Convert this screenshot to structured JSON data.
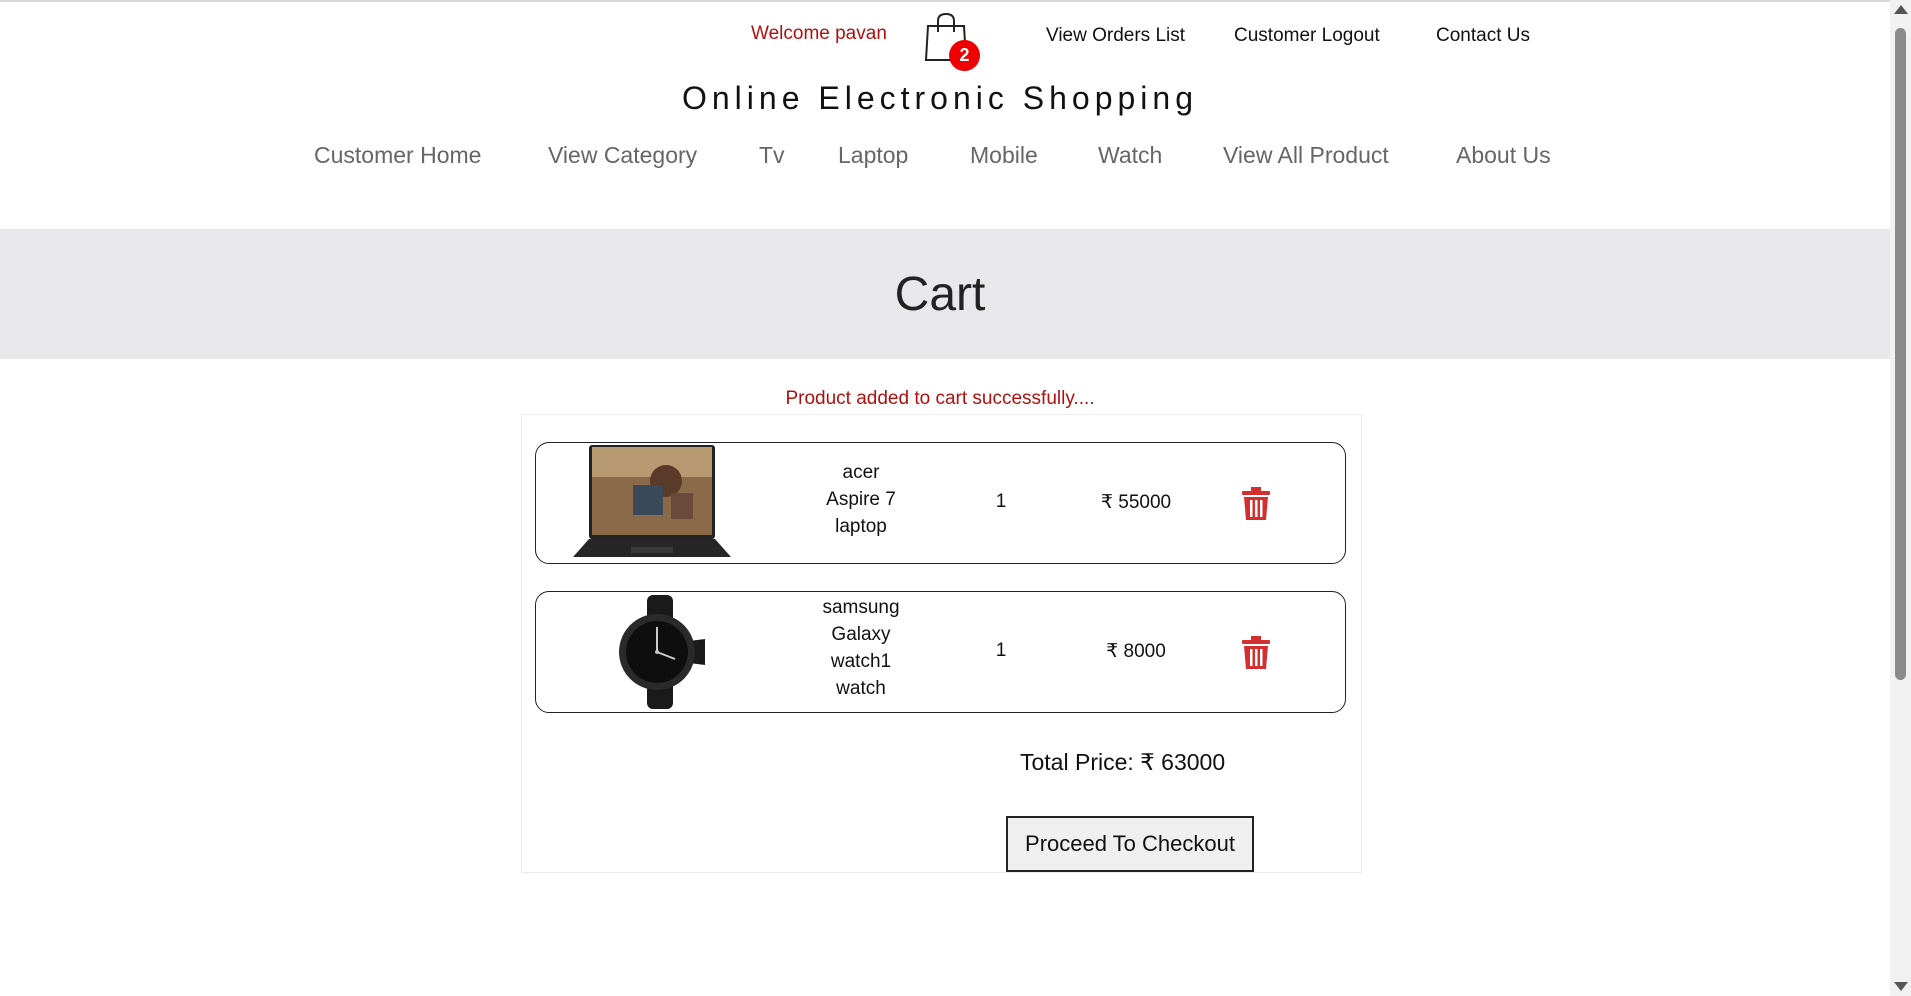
{
  "header": {
    "welcome": "Welcome pavan",
    "cart_count": "2",
    "links": {
      "orders": "View Orders List",
      "logout": "Customer Logout",
      "contact": "Contact Us"
    },
    "site_title": "Online Electronic Shopping"
  },
  "nav": [
    "Customer Home",
    "View Category",
    "Tv",
    "Laptop",
    "Mobile",
    "Watch",
    "View All Product",
    "About Us"
  ],
  "page": {
    "title": "Cart",
    "message": "Product added to cart successfully...."
  },
  "cart": {
    "items": [
      {
        "name_lines": [
          "acer",
          "Aspire 7",
          "laptop"
        ],
        "qty": "1",
        "price": "₹ 55000"
      },
      {
        "name_lines": [
          "samsung",
          "Galaxy",
          "watch1",
          "watch"
        ],
        "qty": "1",
        "price": "₹ 8000"
      }
    ],
    "total": "Total Price: ₹ 63000",
    "checkout_label": "Proceed To Checkout"
  },
  "colors": {
    "accent_red": "#b01010",
    "badge_red": "#ee0000",
    "banner_bg": "#e8e8ea",
    "trash_red": "#d32f2f"
  },
  "icons": {
    "cart": "shopping-bag-icon",
    "delete": "trash-icon"
  }
}
